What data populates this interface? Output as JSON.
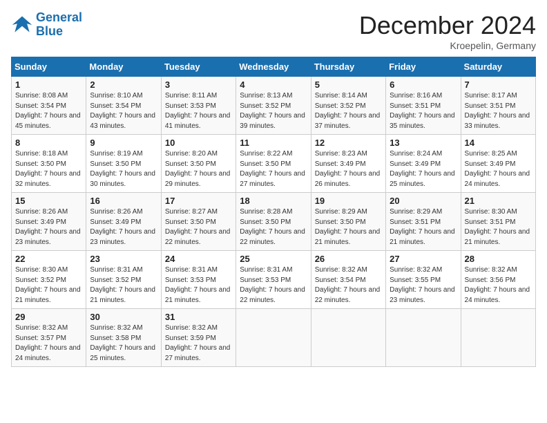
{
  "logo": {
    "line1": "General",
    "line2": "Blue"
  },
  "title": "December 2024",
  "location": "Kroepelin, Germany",
  "days_header": [
    "Sunday",
    "Monday",
    "Tuesday",
    "Wednesday",
    "Thursday",
    "Friday",
    "Saturday"
  ],
  "weeks": [
    [
      {
        "day": "1",
        "sunrise": "8:08 AM",
        "sunset": "3:54 PM",
        "daylight": "7 hours and 45 minutes."
      },
      {
        "day": "2",
        "sunrise": "8:10 AM",
        "sunset": "3:54 PM",
        "daylight": "7 hours and 43 minutes."
      },
      {
        "day": "3",
        "sunrise": "8:11 AM",
        "sunset": "3:53 PM",
        "daylight": "7 hours and 41 minutes."
      },
      {
        "day": "4",
        "sunrise": "8:13 AM",
        "sunset": "3:52 PM",
        "daylight": "7 hours and 39 minutes."
      },
      {
        "day": "5",
        "sunrise": "8:14 AM",
        "sunset": "3:52 PM",
        "daylight": "7 hours and 37 minutes."
      },
      {
        "day": "6",
        "sunrise": "8:16 AM",
        "sunset": "3:51 PM",
        "daylight": "7 hours and 35 minutes."
      },
      {
        "day": "7",
        "sunrise": "8:17 AM",
        "sunset": "3:51 PM",
        "daylight": "7 hours and 33 minutes."
      }
    ],
    [
      {
        "day": "8",
        "sunrise": "8:18 AM",
        "sunset": "3:50 PM",
        "daylight": "7 hours and 32 minutes."
      },
      {
        "day": "9",
        "sunrise": "8:19 AM",
        "sunset": "3:50 PM",
        "daylight": "7 hours and 30 minutes."
      },
      {
        "day": "10",
        "sunrise": "8:20 AM",
        "sunset": "3:50 PM",
        "daylight": "7 hours and 29 minutes."
      },
      {
        "day": "11",
        "sunrise": "8:22 AM",
        "sunset": "3:50 PM",
        "daylight": "7 hours and 27 minutes."
      },
      {
        "day": "12",
        "sunrise": "8:23 AM",
        "sunset": "3:49 PM",
        "daylight": "7 hours and 26 minutes."
      },
      {
        "day": "13",
        "sunrise": "8:24 AM",
        "sunset": "3:49 PM",
        "daylight": "7 hours and 25 minutes."
      },
      {
        "day": "14",
        "sunrise": "8:25 AM",
        "sunset": "3:49 PM",
        "daylight": "7 hours and 24 minutes."
      }
    ],
    [
      {
        "day": "15",
        "sunrise": "8:26 AM",
        "sunset": "3:49 PM",
        "daylight": "7 hours and 23 minutes."
      },
      {
        "day": "16",
        "sunrise": "8:26 AM",
        "sunset": "3:49 PM",
        "daylight": "7 hours and 23 minutes."
      },
      {
        "day": "17",
        "sunrise": "8:27 AM",
        "sunset": "3:50 PM",
        "daylight": "7 hours and 22 minutes."
      },
      {
        "day": "18",
        "sunrise": "8:28 AM",
        "sunset": "3:50 PM",
        "daylight": "7 hours and 22 minutes."
      },
      {
        "day": "19",
        "sunrise": "8:29 AM",
        "sunset": "3:50 PM",
        "daylight": "7 hours and 21 minutes."
      },
      {
        "day": "20",
        "sunrise": "8:29 AM",
        "sunset": "3:51 PM",
        "daylight": "7 hours and 21 minutes."
      },
      {
        "day": "21",
        "sunrise": "8:30 AM",
        "sunset": "3:51 PM",
        "daylight": "7 hours and 21 minutes."
      }
    ],
    [
      {
        "day": "22",
        "sunrise": "8:30 AM",
        "sunset": "3:52 PM",
        "daylight": "7 hours and 21 minutes."
      },
      {
        "day": "23",
        "sunrise": "8:31 AM",
        "sunset": "3:52 PM",
        "daylight": "7 hours and 21 minutes."
      },
      {
        "day": "24",
        "sunrise": "8:31 AM",
        "sunset": "3:53 PM",
        "daylight": "7 hours and 21 minutes."
      },
      {
        "day": "25",
        "sunrise": "8:31 AM",
        "sunset": "3:53 PM",
        "daylight": "7 hours and 22 minutes."
      },
      {
        "day": "26",
        "sunrise": "8:32 AM",
        "sunset": "3:54 PM",
        "daylight": "7 hours and 22 minutes."
      },
      {
        "day": "27",
        "sunrise": "8:32 AM",
        "sunset": "3:55 PM",
        "daylight": "7 hours and 23 minutes."
      },
      {
        "day": "28",
        "sunrise": "8:32 AM",
        "sunset": "3:56 PM",
        "daylight": "7 hours and 24 minutes."
      }
    ],
    [
      {
        "day": "29",
        "sunrise": "8:32 AM",
        "sunset": "3:57 PM",
        "daylight": "7 hours and 24 minutes."
      },
      {
        "day": "30",
        "sunrise": "8:32 AM",
        "sunset": "3:58 PM",
        "daylight": "7 hours and 25 minutes."
      },
      {
        "day": "31",
        "sunrise": "8:32 AM",
        "sunset": "3:59 PM",
        "daylight": "7 hours and 27 minutes."
      },
      null,
      null,
      null,
      null
    ]
  ]
}
